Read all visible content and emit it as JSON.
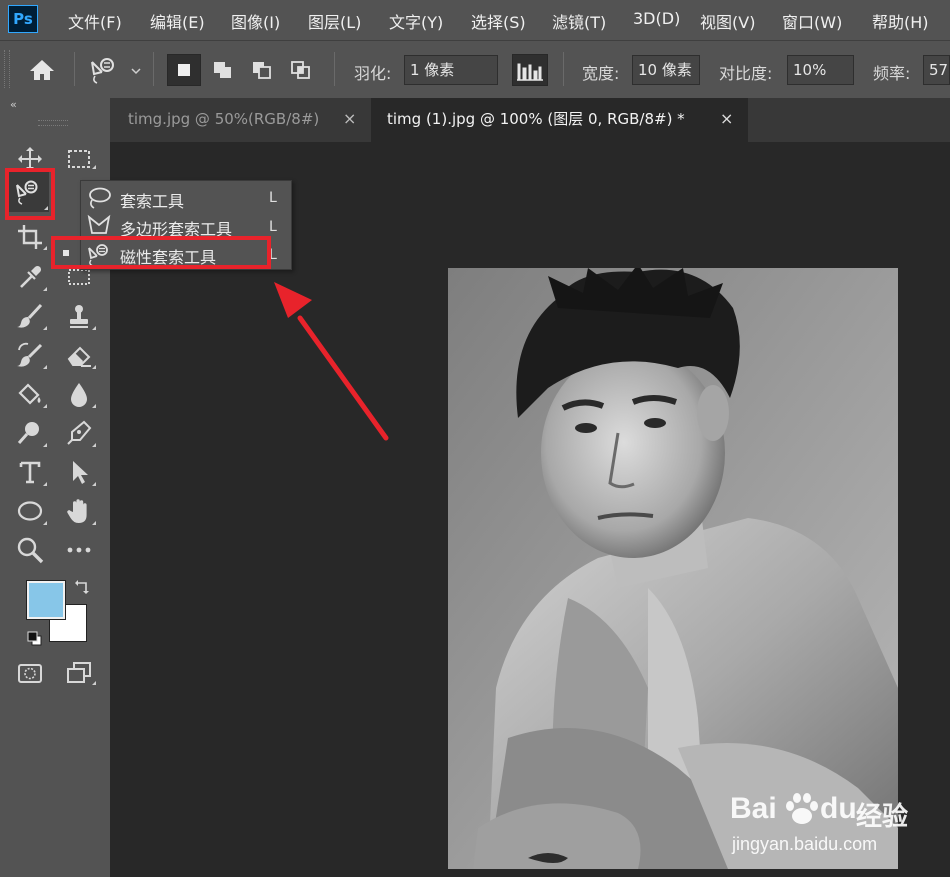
{
  "app": {
    "logo_text": "Ps"
  },
  "menu": [
    "文件(F)",
    "编辑(E)",
    "图像(I)",
    "图层(L)",
    "文字(Y)",
    "选择(S)",
    "滤镜(T)",
    "3D(D)",
    "视图(V)",
    "窗口(W)",
    "帮助(H)"
  ],
  "options_bar": {
    "feather_label": "羽化:",
    "feather_value": "1 像素",
    "width_label": "宽度:",
    "width_value": "10 像素",
    "contrast_label": "对比度:",
    "contrast_value": "10%",
    "frequency_label": "频率:",
    "frequency_value": "57"
  },
  "tabs": [
    {
      "label": "timg.jpg @ 50%(RGB/8#)",
      "close": "×",
      "active": false
    },
    {
      "label": "timg (1).jpg @ 100% (图层 0, RGB/8#) *",
      "close": "×",
      "active": true
    }
  ],
  "toolbox": {
    "collapse_glyph": "‹‹"
  },
  "colors": {
    "foreground": "#87c6e8",
    "background": "#ffffff",
    "highlight": "#e8232b"
  },
  "lasso_flyout": {
    "items": [
      {
        "label": "套索工具",
        "shortcut": "L",
        "selected": false,
        "icon": "lasso-icon"
      },
      {
        "label": "多边形套索工具",
        "shortcut": "L",
        "selected": false,
        "icon": "polygonal-lasso-icon"
      },
      {
        "label": "磁性套索工具",
        "shortcut": "L",
        "selected": true,
        "icon": "magnetic-lasso-icon"
      }
    ]
  },
  "watermark": {
    "brand_latin_1": "Bai",
    "brand_latin_2": "du",
    "brand_cn": "经验",
    "url": "jingyan.baidu.com"
  }
}
